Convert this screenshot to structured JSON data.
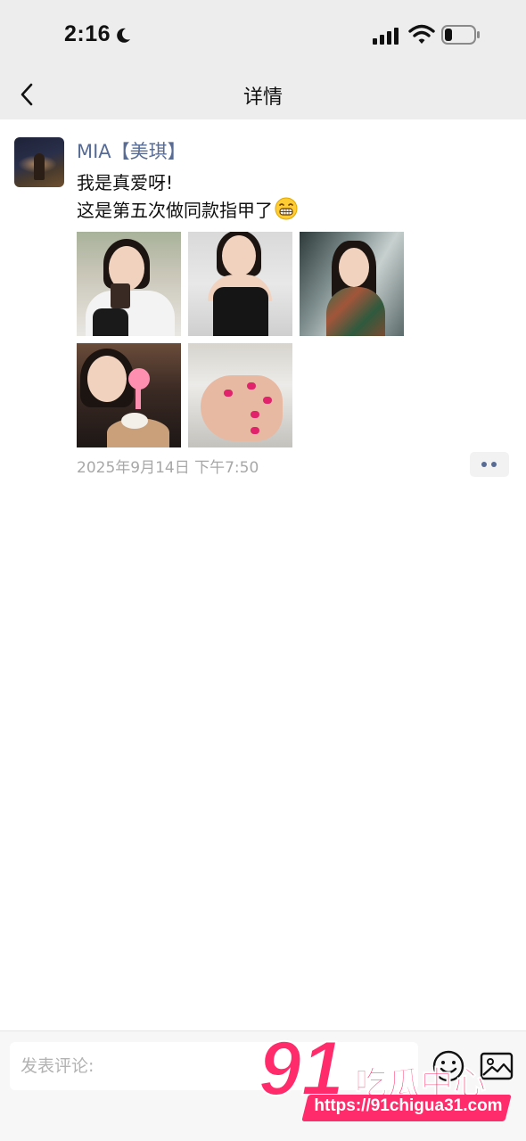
{
  "status_bar": {
    "time": "2:16",
    "icons": [
      "moon-icon",
      "cellular-signal-icon",
      "wifi-icon",
      "battery-icon"
    ]
  },
  "nav": {
    "title": "详情",
    "back_icon": "chevron-left-icon"
  },
  "post": {
    "username": "MIA【美琪】",
    "text_line1": "我是真爱呀!",
    "text_line2": "这是第五次做同款指甲了",
    "emoji": "grinning-face-emoji",
    "photo_count": 5,
    "timestamp": "2025年9月14日 下午7:50",
    "more_icon": "more-dots-icon"
  },
  "comment_bar": {
    "placeholder": "发表评论:",
    "emoji_icon": "emoji-face-icon",
    "image_icon": "image-icon"
  },
  "watermark": {
    "logo_text": "91吃瓜中心",
    "url": "https://91chigua31.com"
  },
  "colors": {
    "name_link": "#576b95",
    "timestamp": "#a8a8a8",
    "bar_background": "#ededed",
    "watermark_pink": "#ff2b6a"
  }
}
